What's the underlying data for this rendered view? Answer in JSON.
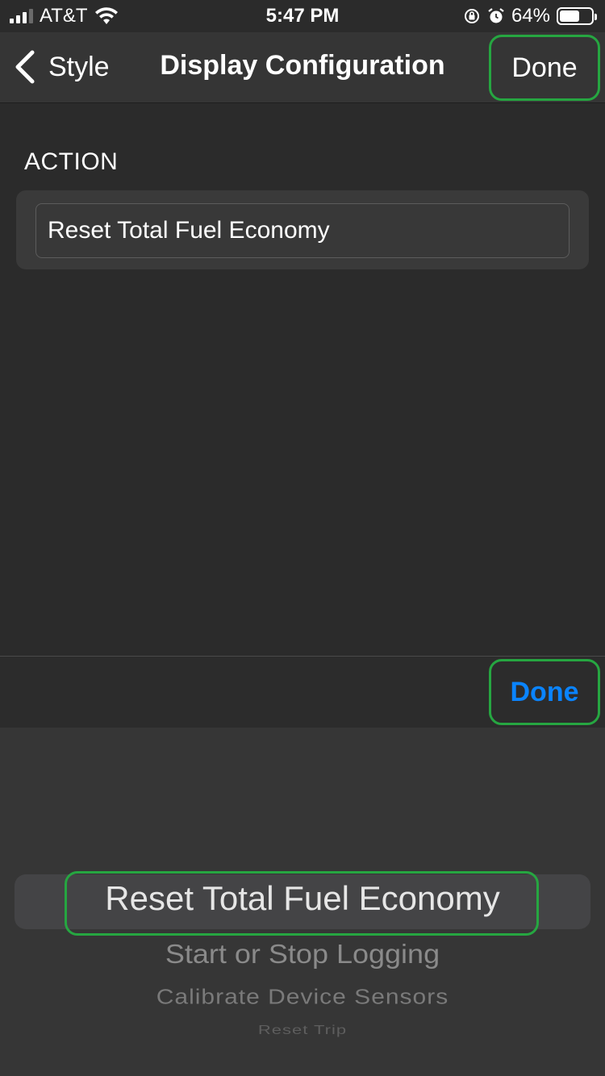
{
  "status_bar": {
    "carrier": "AT&T",
    "time": "5:47 PM",
    "battery_percent": "64%",
    "battery_level": 0.64
  },
  "nav": {
    "back_label": "Style",
    "title": "Display Configuration",
    "done_label": "Done"
  },
  "section": {
    "header": "ACTION",
    "field_value": "Reset Total Fuel Economy"
  },
  "picker_toolbar": {
    "done_label": "Done"
  },
  "picker": {
    "selected": "Reset Total Fuel Economy",
    "options": [
      "Start or Stop Logging",
      "Calibrate Device Sensors",
      "Reset Trip"
    ]
  },
  "colors": {
    "accent": "#0a84ff",
    "highlight_outline": "#26a641",
    "background": "#2b2b2b"
  }
}
